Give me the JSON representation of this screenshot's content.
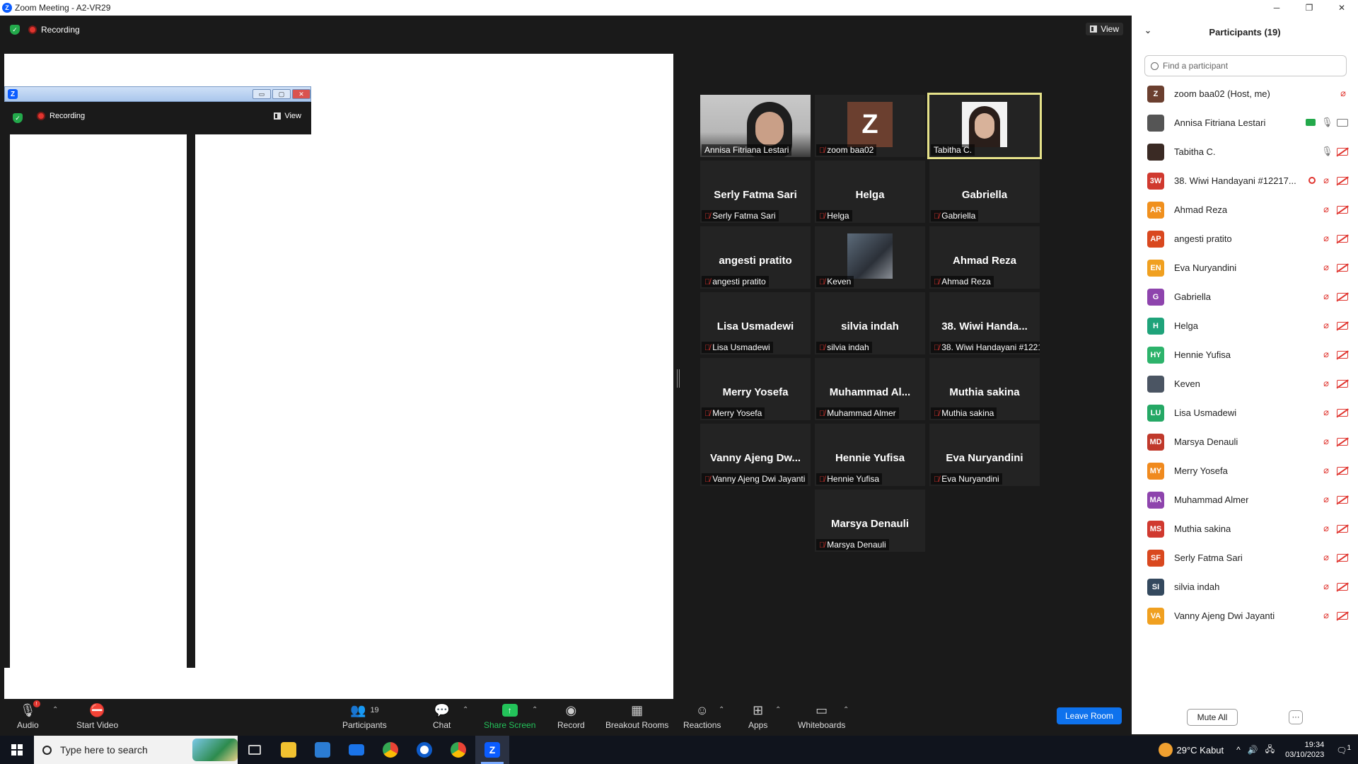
{
  "window": {
    "title": "Zoom Meeting - A2-VR29",
    "min": "─",
    "restore": "❐",
    "close": "✕"
  },
  "topbar": {
    "recording": "Recording",
    "view": "View"
  },
  "nested": {
    "recording": "Recording",
    "view": "View",
    "min": "▭",
    "max": "▢",
    "close": "✕"
  },
  "tiles": [
    {
      "big": "",
      "label": "Annisa Fitriana Lestari",
      "muted": false,
      "kind": "photo1"
    },
    {
      "big": "",
      "label": "zoom baa02",
      "muted": true,
      "kind": "zbox",
      "initial": "Z"
    },
    {
      "big": "",
      "label": "Tabitha C.",
      "muted": false,
      "kind": "photo2",
      "active": true
    },
    {
      "big": "Serly Fatma Sari",
      "label": "Serly Fatma Sari",
      "muted": true
    },
    {
      "big": "Helga",
      "label": "Helga",
      "muted": true
    },
    {
      "big": "Gabriella",
      "label": "Gabriella",
      "muted": true
    },
    {
      "big": "angesti pratito",
      "label": "angesti pratito",
      "muted": true
    },
    {
      "big": "",
      "label": "Keven",
      "muted": true,
      "kind": "photo3"
    },
    {
      "big": "Ahmad Reza",
      "label": "Ahmad Reza",
      "muted": true
    },
    {
      "big": "Lisa Usmadewi",
      "label": "Lisa Usmadewi",
      "muted": true
    },
    {
      "big": "silvia indah",
      "label": "silvia indah",
      "muted": true
    },
    {
      "big": "38. Wiwi Handa...",
      "label": "38. Wiwi Handayani #1221...",
      "muted": true
    },
    {
      "big": "Merry Yosefa",
      "label": "Merry Yosefa",
      "muted": true
    },
    {
      "big": "Muhammad Al...",
      "label": "Muhammad Almer",
      "muted": true
    },
    {
      "big": "Muthia sakina",
      "label": "Muthia sakina",
      "muted": true
    },
    {
      "big": "Vanny Ajeng Dw...",
      "label": "Vanny Ajeng Dwi Jayanti",
      "muted": true
    },
    {
      "big": "Hennie Yufisa",
      "label": "Hennie Yufisa",
      "muted": true
    },
    {
      "big": "Eva Nuryandini",
      "label": "Eva Nuryandini",
      "muted": true
    },
    {
      "big": "Marsya Denauli",
      "label": "Marsya Denauli",
      "muted": true
    }
  ],
  "panel": {
    "title": "Participants (19)",
    "search_placeholder": "Find a participant",
    "mute_all": "Mute All",
    "more": "···",
    "participants": [
      {
        "name": "zoom baa02 (Host, me)",
        "initials": "Z",
        "color": "#6b3f2f",
        "mic": "off",
        "cam": "none"
      },
      {
        "name": "Annisa Fitriana Lestari",
        "initials": "",
        "color": "#555",
        "mic": "on",
        "cam": "on",
        "share": true
      },
      {
        "name": "Tabitha C.",
        "initials": "",
        "color": "#3a2a24",
        "mic": "on",
        "cam": "off"
      },
      {
        "name": "38. Wiwi Handayani #12217...",
        "initials": "3W",
        "color": "#d0392f",
        "mic": "off",
        "cam": "off",
        "rec": true
      },
      {
        "name": "Ahmad Reza",
        "initials": "AR",
        "color": "#f0901e",
        "mic": "off",
        "cam": "off"
      },
      {
        "name": "angesti pratito",
        "initials": "AP",
        "color": "#d9481f",
        "mic": "off",
        "cam": "off"
      },
      {
        "name": "Eva Nuryandini",
        "initials": "EN",
        "color": "#f0a020",
        "mic": "off",
        "cam": "off"
      },
      {
        "name": "Gabriella",
        "initials": "G",
        "color": "#8e44ad",
        "mic": "off",
        "cam": "off"
      },
      {
        "name": "Helga",
        "initials": "H",
        "color": "#1fa37a",
        "mic": "off",
        "cam": "off"
      },
      {
        "name": "Hennie Yufisa",
        "initials": "HY",
        "color": "#2db36b",
        "mic": "off",
        "cam": "off"
      },
      {
        "name": "Keven",
        "initials": "",
        "color": "#4b5563",
        "mic": "off",
        "cam": "off"
      },
      {
        "name": "Lisa Usmadewi",
        "initials": "LU",
        "color": "#25a865",
        "mic": "off",
        "cam": "off"
      },
      {
        "name": "Marsya Denauli",
        "initials": "MD",
        "color": "#c0392b",
        "mic": "off",
        "cam": "off"
      },
      {
        "name": "Merry Yosefa",
        "initials": "MY",
        "color": "#f08a1e",
        "mic": "off",
        "cam": "off"
      },
      {
        "name": "Muhammad Almer",
        "initials": "MA",
        "color": "#8e44ad",
        "mic": "off",
        "cam": "off"
      },
      {
        "name": "Muthia sakina",
        "initials": "MS",
        "color": "#d0392f",
        "mic": "off",
        "cam": "off"
      },
      {
        "name": "Serly Fatma Sari",
        "initials": "SF",
        "color": "#d9481f",
        "mic": "off",
        "cam": "off"
      },
      {
        "name": "silvia indah",
        "initials": "SI",
        "color": "#34495e",
        "mic": "off",
        "cam": "off"
      },
      {
        "name": "Vanny Ajeng Dwi Jayanti",
        "initials": "VA",
        "color": "#f0a020",
        "mic": "off",
        "cam": "off"
      }
    ]
  },
  "toolbar": {
    "audio": "Audio",
    "start_video": "Start Video",
    "participants": "Participants",
    "participants_count": "19",
    "chat": "Chat",
    "share_screen": "Share Screen",
    "record": "Record",
    "breakout": "Breakout Rooms",
    "reactions": "Reactions",
    "apps": "Apps",
    "whiteboards": "Whiteboards",
    "leave": "Leave Room"
  },
  "taskbar": {
    "search_placeholder": "Type here to search",
    "weather": "29°C  Kabut",
    "time": "19:34",
    "date": "03/10/2023",
    "notif_count": "1"
  }
}
